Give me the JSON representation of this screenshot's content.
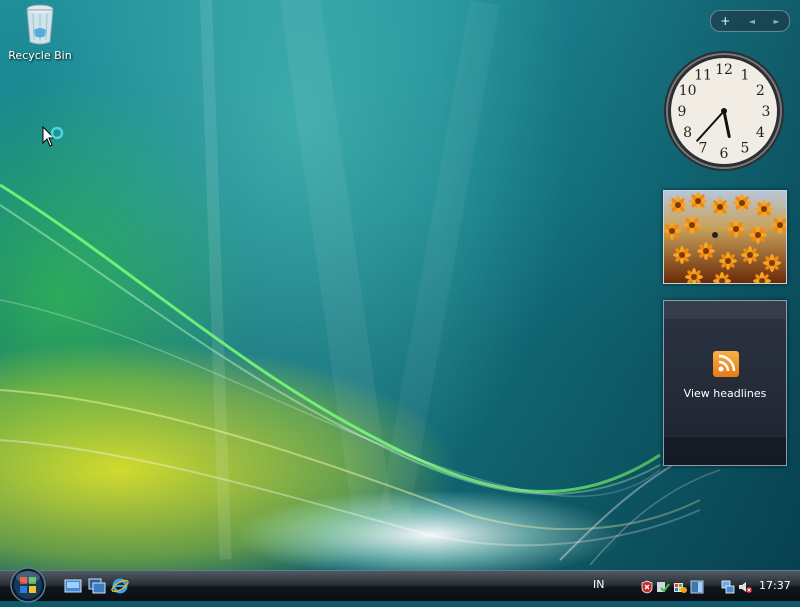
{
  "desktop": {
    "icons": [
      {
        "label": "Recycle Bin",
        "icon": "recycle-bin-icon"
      }
    ]
  },
  "sidebar": {
    "toolbar": {
      "add_label": "+",
      "prev_label": "◄",
      "next_label": "►"
    },
    "clock": {
      "numbers": [
        "12",
        "1",
        "2",
        "3",
        "4",
        "5",
        "6",
        "7",
        "8",
        "9",
        "10",
        "11"
      ],
      "hour": 5,
      "minute": 37
    },
    "slideshow": {
      "subject": "orange flowers"
    },
    "feed": {
      "label": "View headlines",
      "icon": "rss-icon"
    }
  },
  "taskbar": {
    "language": "IN",
    "time": "17:37",
    "quick_launch": [
      "show-desktop-icon",
      "switch-windows-icon",
      "internet-explorer-icon"
    ],
    "tray_icons": [
      "security-alert-icon",
      "defender-check-icon",
      "updates-icon",
      "sidebar-tray-icon",
      "network-icon",
      "volume-muted-icon"
    ]
  },
  "colors": {
    "accent": "#2a8f9a",
    "rss": "#f08a24"
  }
}
